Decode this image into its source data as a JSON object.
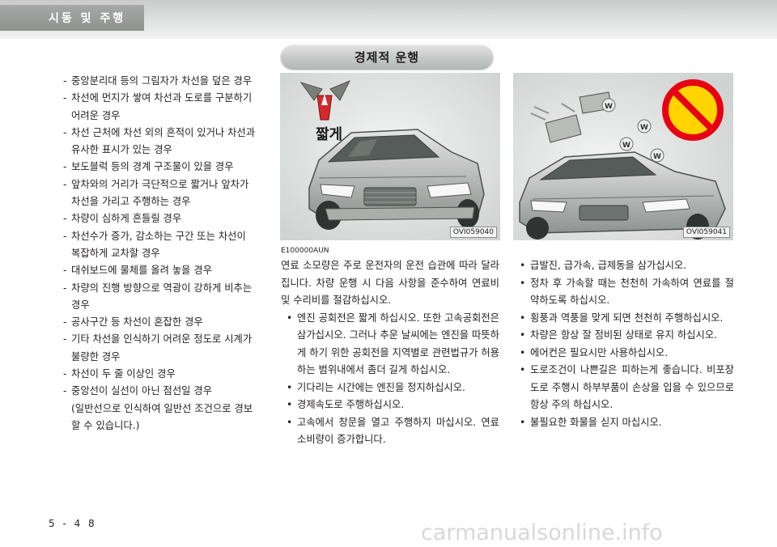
{
  "header": {
    "section_title": "시동 및 주행"
  },
  "left_list": [
    {
      "text": "- 중앙분리대 등의 그림자가 차선을 덮은 경우",
      "cont": false
    },
    {
      "text": "- 차선에 먼지가 쌓여 차선과 도로를 구분하기",
      "cont": false
    },
    {
      "text": "어려운 경우",
      "cont": true
    },
    {
      "text": "- 차선 근처에 차선 외의 흔적이 있거나 차선과",
      "cont": false
    },
    {
      "text": "유사한 표시가 있는 경우",
      "cont": true
    },
    {
      "text": "- 보도블럭 등의 경계 구조물이 있을 경우",
      "cont": false
    },
    {
      "text": "- 앞차와의 거리가 극단적으로 짧거나 앞차가",
      "cont": false
    },
    {
      "text": "차선을 가리고 주행하는 경우",
      "cont": true
    },
    {
      "text": "- 차량이 심하게 흔들릴 경우",
      "cont": false
    },
    {
      "text": "- 차선수가 증가, 감소하는 구간 또는 차선이",
      "cont": false
    },
    {
      "text": "복잡하게 교차할 경우",
      "cont": true
    },
    {
      "text": "- 대쉬보드에 물체를 올려 놓을 경우",
      "cont": false
    },
    {
      "text": "- 차량의 진행 방향으로 역광이 강하게 비추는",
      "cont": false
    },
    {
      "text": "경우",
      "cont": true
    },
    {
      "text": "- 공사구간 등 차선이 혼잡한 경우",
      "cont": false
    },
    {
      "text": "- 기타 차선을 인식하기 어려운 정도로 시계가",
      "cont": false
    },
    {
      "text": "불량한 경우",
      "cont": true
    },
    {
      "text": "- 차선이 두 줄 이상인 경우",
      "cont": false
    },
    {
      "text": "- 중앙선이 실선이 아닌 점선일 경우",
      "cont": false
    },
    {
      "text": "(일반선으로 인식하여 일반선 조건으로 경보",
      "cont": true
    },
    {
      "text": "할 수 있습니다.)",
      "cont": true
    }
  ],
  "section_header": {
    "title": "경제적 운행"
  },
  "illustrations": {
    "left": {
      "caption_word": "짧게",
      "code": "OVI059040"
    },
    "right": {
      "code": "OVI059041",
      "tag_letter": "W"
    }
  },
  "doc_code": "E100000AUN",
  "intro": "연료 소모량은 주로 운전자의 운전 습관에 따라 달라집니다. 차량 운행 시 다음 사항을 준수하여 연료비 및 수리비를 절감하십시오.",
  "middle_bullets": [
    "엔진 공회전은 짧게 하십시오. 또한 고속공회전은 삼가십시오. 그러나 추운 날씨에는 엔진을 따뜻하게 하기 위한 공회전을 지역별로 관련법규가 허용하는 범위내에서 좀더 길게 하십시오.",
    "기다리는 시간에는 엔진을 정지하십시오.",
    "경제속도로 주행하십시오.",
    "고속에서 창문을 열고 주행하지 마십시오. 연료 소비량이 증가합니다."
  ],
  "right_bullets": [
    "급발진, 급가속, 급제동을 삼가십시오.",
    "정차 후 가속할 때는 천천히 가속하여 연료를 절약하도록 하십시오.",
    "횡풍과 역풍을 맞게 되면 천천히 주행하십시오.",
    "차량은 항상 잘 정비된 상태로 유지 하십시오.",
    "에어컨은 필요시만 사용하십시오.",
    "도로조건이 나쁜길은 피하는게 좋습니다. 비포장도로 주행시 하부부품이 손상을 입을 수 있으므로 항상 주의 하십시오.",
    "불필요한 화물을 싣지 마십시오."
  ],
  "footer": {
    "page_number": "5 - 4 8",
    "watermark": "carmanualsonline.info"
  }
}
